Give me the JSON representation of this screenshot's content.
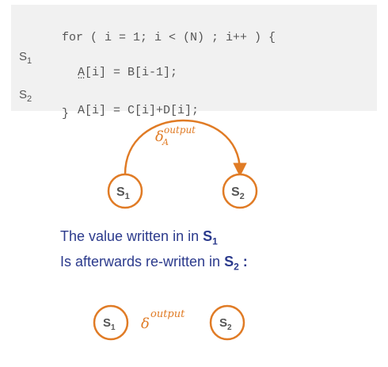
{
  "code": {
    "lines": [
      {
        "label": "",
        "text": "for ( i = 1; i < (N) ; i++ ) {"
      },
      {
        "label": "S1",
        "text": "A[i] = B[i-1];"
      },
      {
        "label": "",
        "text": "…"
      },
      {
        "label": "S2",
        "text": "A[i] = C[i]+D[i];"
      },
      {
        "label": "",
        "text": "}"
      }
    ]
  },
  "graph_top": {
    "node1": {
      "main": "S",
      "sub": "1"
    },
    "node2": {
      "main": "S",
      "sub": "2"
    },
    "edge_label": {
      "symbol": "δ",
      "sup": "output",
      "sub": "A"
    }
  },
  "explanation": {
    "line1_prefix": "The value written in in ",
    "line1_node": "S",
    "line1_node_sub": "1",
    "line2_prefix": "Is afterwards re-written in ",
    "line2_node": "S",
    "line2_node_sub": "2",
    "line2_suffix": " :"
  },
  "graph_bottom": {
    "node1": {
      "main": "S",
      "sub": "1"
    },
    "node2": {
      "main": "S",
      "sub": "2"
    },
    "edge_label": {
      "symbol": "δ",
      "sup": "output"
    }
  },
  "colors": {
    "accent": "#e07b25",
    "text": "#555555",
    "blue": "#2b3a8c",
    "code_bg": "#f1f1f1"
  }
}
